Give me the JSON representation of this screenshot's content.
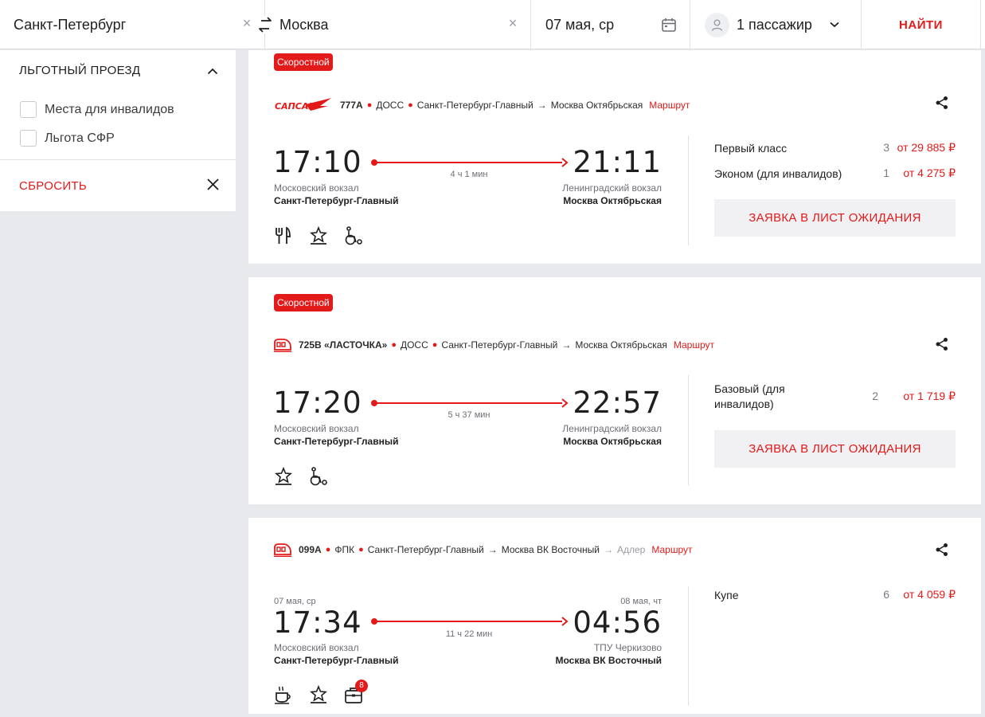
{
  "search": {
    "from": "Санкт-Петербург",
    "to": "Москва",
    "date": "07 мая, ср",
    "passengers": "1 пассажир",
    "find_label": "НАЙТИ",
    "clear_glyph": "×"
  },
  "filter": {
    "title": "ЛЬГОТНЫЙ ПРОЕЗД",
    "options": [
      {
        "label": "Места для инвалидов",
        "checked": false
      },
      {
        "label": "Льгота СФР",
        "checked": false
      }
    ],
    "reset_label": "СБРОСИТЬ"
  },
  "trains": [
    {
      "badge": "Скоростной",
      "number": "777А",
      "carrier": "ДОСС",
      "from_station": "Санкт-Петербург-Главный",
      "to_station": "Москва Октябрьская",
      "arrow": "→",
      "route_label": "Маршрут",
      "logo": "sapsan-logo",
      "dep_time": "17:10",
      "arr_time": "21:11",
      "duration": "4 ч 1 мин",
      "dep_terminal": "Московский вокзал",
      "arr_terminal": "Ленинградский вокзал",
      "dep_city_station": "Санкт-Петербург-Главный",
      "arr_city_station": "Москва Октябрьская",
      "amenities": [
        "restaurant-icon",
        "comfort-star-icon",
        "wheelchair-icon"
      ],
      "classes": [
        {
          "name": "Первый класс",
          "seats": "3",
          "price": "от 29 885 ₽"
        },
        {
          "name": "Эконом (для инвалидов)",
          "seats": "1",
          "price": "от 4 275 ₽"
        }
      ],
      "wait_button": "ЗАЯВКА В ЛИСТ ОЖИДАНИЯ"
    },
    {
      "badge": "Скоростной",
      "number": "725В «ЛАСТОЧКА»",
      "carrier": "ДОСС",
      "from_station": "Санкт-Петербург-Главный",
      "to_station": "Москва Октябрьская",
      "arrow": "→",
      "route_label": "Маршрут",
      "logo": "train-icon",
      "dep_time": "17:20",
      "arr_time": "22:57",
      "duration": "5 ч 37 мин",
      "dep_terminal": "Московский вокзал",
      "arr_terminal": "Ленинградский вокзал",
      "dep_city_station": "Санкт-Петербург-Главный",
      "arr_city_station": "Москва Октябрьская",
      "amenities": [
        "comfort-star-icon",
        "wheelchair-icon"
      ],
      "classes": [
        {
          "name": "Базовый (для инвалидов)",
          "seats": "2",
          "price": "от 1 719 ₽"
        }
      ],
      "wait_button": "ЗАЯВКА В ЛИСТ ОЖИДАНИЯ"
    },
    {
      "number": "099А",
      "carrier": "ФПК",
      "from_station": "Санкт-Петербург-Главный",
      "to_station": "Москва ВК Восточный",
      "final_station": "Адлер",
      "arrow": "→",
      "route_label": "Маршрут",
      "logo": "train-icon",
      "dep_date": "07 мая, ср",
      "arr_date": "08 мая, чт",
      "dep_time": "17:34",
      "arr_time": "04:56",
      "duration": "11 ч 22 мин",
      "dep_terminal": "Московский вокзал",
      "arr_terminal": "ТПУ Черкизово",
      "dep_city_station": "Санкт-Петербург-Главный",
      "arr_city_station": "Москва ВК Восточный",
      "amenities": [
        "hot-drink-icon",
        "comfort-star-icon",
        "luggage-icon"
      ],
      "luggage_count": "8",
      "classes": [
        {
          "name": "Купе",
          "seats": "6",
          "price": "от 4 059 ₽"
        }
      ]
    }
  ],
  "colors": {
    "accent": "#e21a1a",
    "background": "#e8e9ed",
    "card": "#ffffff"
  }
}
